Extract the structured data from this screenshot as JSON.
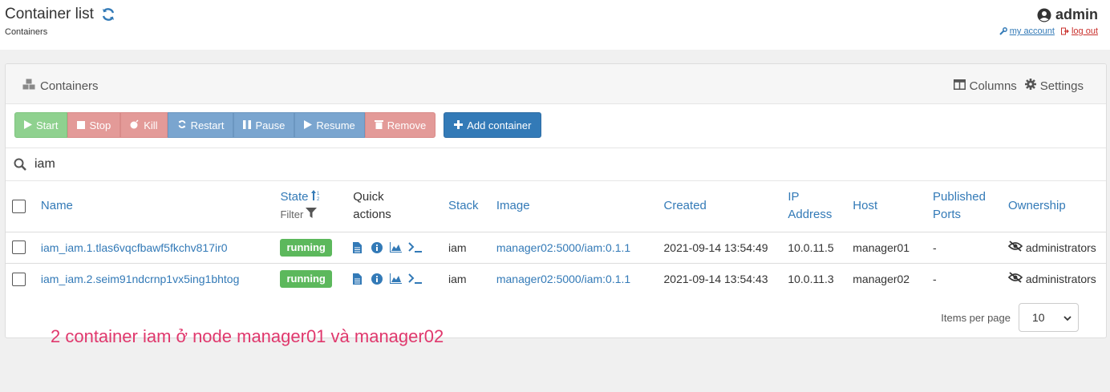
{
  "header": {
    "title": "Container list",
    "breadcrumb": "Containers",
    "user": "admin",
    "my_account": "my account",
    "log_out": "log out"
  },
  "widget": {
    "title": "Containers",
    "columns_label": "Columns",
    "settings_label": "Settings"
  },
  "toolbar": {
    "start": "Start",
    "stop": "Stop",
    "kill": "Kill",
    "restart": "Restart",
    "pause": "Pause",
    "resume": "Resume",
    "remove": "Remove",
    "add": "Add container"
  },
  "search": {
    "value": "iam"
  },
  "table": {
    "headers": {
      "name": "Name",
      "state": "State",
      "filter": "Filter",
      "quick": "Quick actions",
      "stack": "Stack",
      "image": "Image",
      "created": "Created",
      "ip": "IP Address",
      "host": "Host",
      "ports": "Published Ports",
      "ownership": "Ownership"
    },
    "rows": [
      {
        "name": "iam_iam.1.tlas6vqcfbawf5fkchv817ir0",
        "state": "running",
        "stack": "iam",
        "image": "manager02:5000/iam:0.1.1",
        "created": "2021-09-14 13:54:49",
        "ip": "10.0.11.5",
        "host": "manager01",
        "ports": "-",
        "ownership": "administrators"
      },
      {
        "name": "iam_iam.2.seim91ndcrnp1vx5ing1bhtog",
        "state": "running",
        "stack": "iam",
        "image": "manager02:5000/iam:0.1.1",
        "created": "2021-09-14 13:54:43",
        "ip": "10.0.11.3",
        "host": "manager02",
        "ports": "-",
        "ownership": "administrators"
      }
    ]
  },
  "pager": {
    "label": "Items per page",
    "value": "10"
  },
  "annotation": "2 container iam ở node manager01 và manager02",
  "colors": {
    "primary": "#337ab7",
    "running": "#5cb85c",
    "annotation": "#e0386d"
  }
}
